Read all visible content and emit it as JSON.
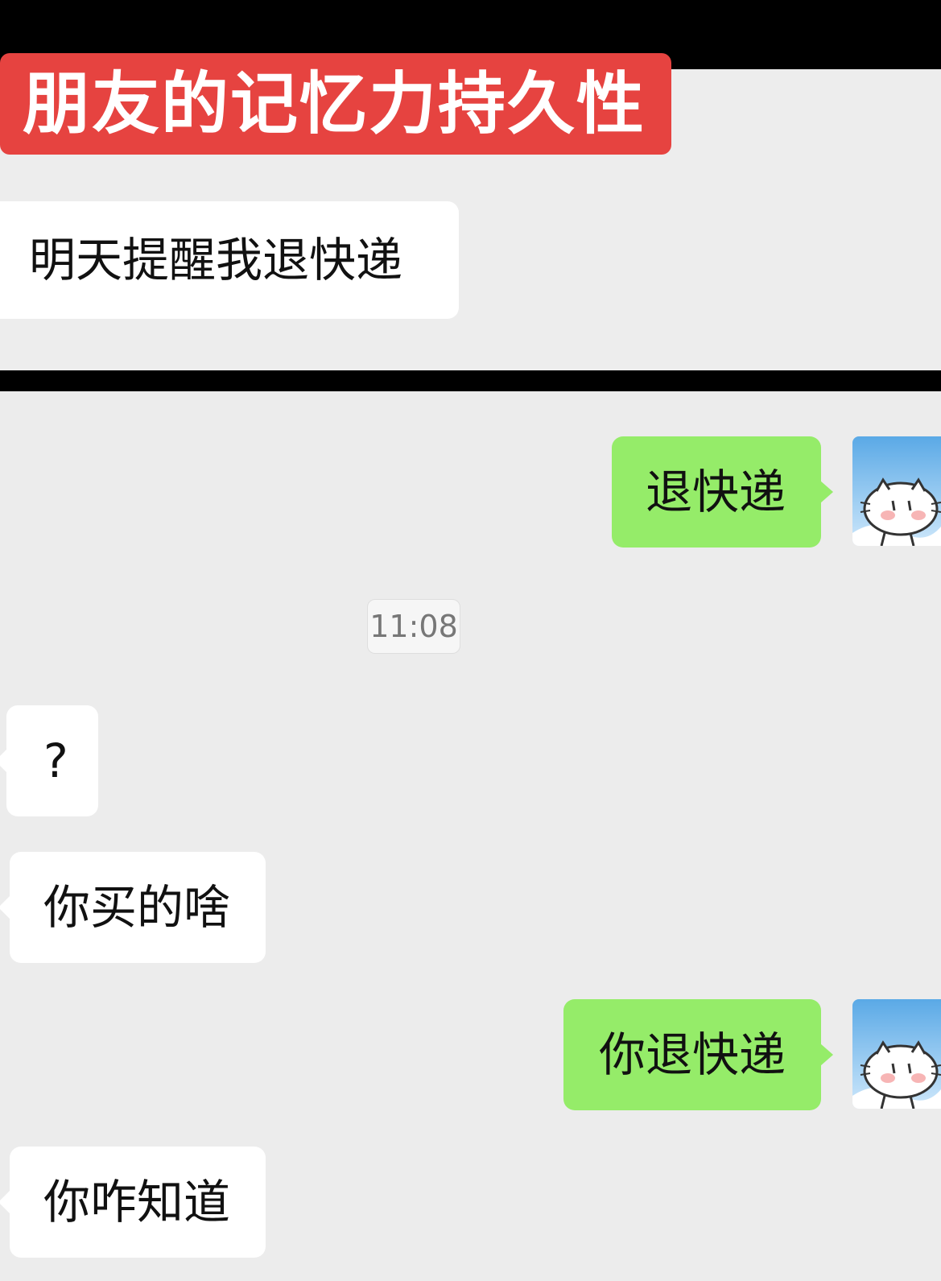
{
  "title": "朋友的记忆力持久性",
  "timestamp": "11:08",
  "colors": {
    "title_bg": "#e64340",
    "sent_bubble": "#95ec69",
    "received_bubble": "#ffffff",
    "chat_bg": "#ececec"
  },
  "messages": [
    {
      "side": "left",
      "text": "明天提醒我退快递"
    },
    {
      "side": "right",
      "text": "退快递",
      "avatar": "cat-avatar-icon"
    },
    {
      "side": "left",
      "text": "?"
    },
    {
      "side": "left",
      "text": "你买的啥"
    },
    {
      "side": "right",
      "text": "你退快递",
      "avatar": "cat-avatar-icon"
    },
    {
      "side": "left",
      "text": "你咋知道"
    }
  ]
}
